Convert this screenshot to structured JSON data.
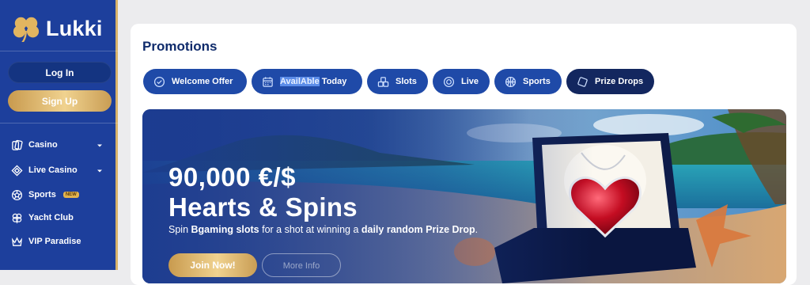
{
  "brand": {
    "name": "Lukki",
    "icon": "clover-icon"
  },
  "auth": {
    "login_label": "Log In",
    "signup_label": "Sign Up"
  },
  "sidebar": {
    "items": [
      {
        "label": "Casino",
        "icon": "cards-icon",
        "has_chevron": true
      },
      {
        "label": "Live Casino",
        "icon": "diamond-icon",
        "has_chevron": true
      },
      {
        "label": "Sports",
        "icon": "ball-icon",
        "badge": "NEW"
      },
      {
        "label": "Yacht Club",
        "icon": "clover-outline-icon"
      },
      {
        "label": "VIP Paradise",
        "icon": "crown-icon"
      }
    ]
  },
  "page": {
    "title": "Promotions"
  },
  "tabs": [
    {
      "label": "Welcome Offer",
      "icon": "check-circle-icon"
    },
    {
      "label_highlight": "AvailAble",
      "label_rest": " Today",
      "icon": "calendar-icon"
    },
    {
      "label": "Slots",
      "icon": "slots-icon"
    },
    {
      "label": "Live",
      "icon": "live-icon"
    },
    {
      "label": "Sports",
      "icon": "ball-icon"
    },
    {
      "label": "Prize Drops",
      "icon": "gem-icon",
      "active": true
    }
  ],
  "banner": {
    "amount": "90,000 €/$",
    "title": "Hearts & Spins",
    "subtitle_pre": "Spin ",
    "subtitle_b1": "Bgaming slots",
    "subtitle_mid": " for a shot at winning a ",
    "subtitle_b2": "daily random Prize Drop",
    "subtitle_end": ".",
    "join_label": "Join Now!",
    "more_label": "More Info"
  },
  "colors": {
    "sidebar": "#1d3f9c",
    "tab": "#1f4aa8",
    "tab_active": "#13275f",
    "gold": "#d8b26a",
    "title": "#0f2b6b"
  }
}
